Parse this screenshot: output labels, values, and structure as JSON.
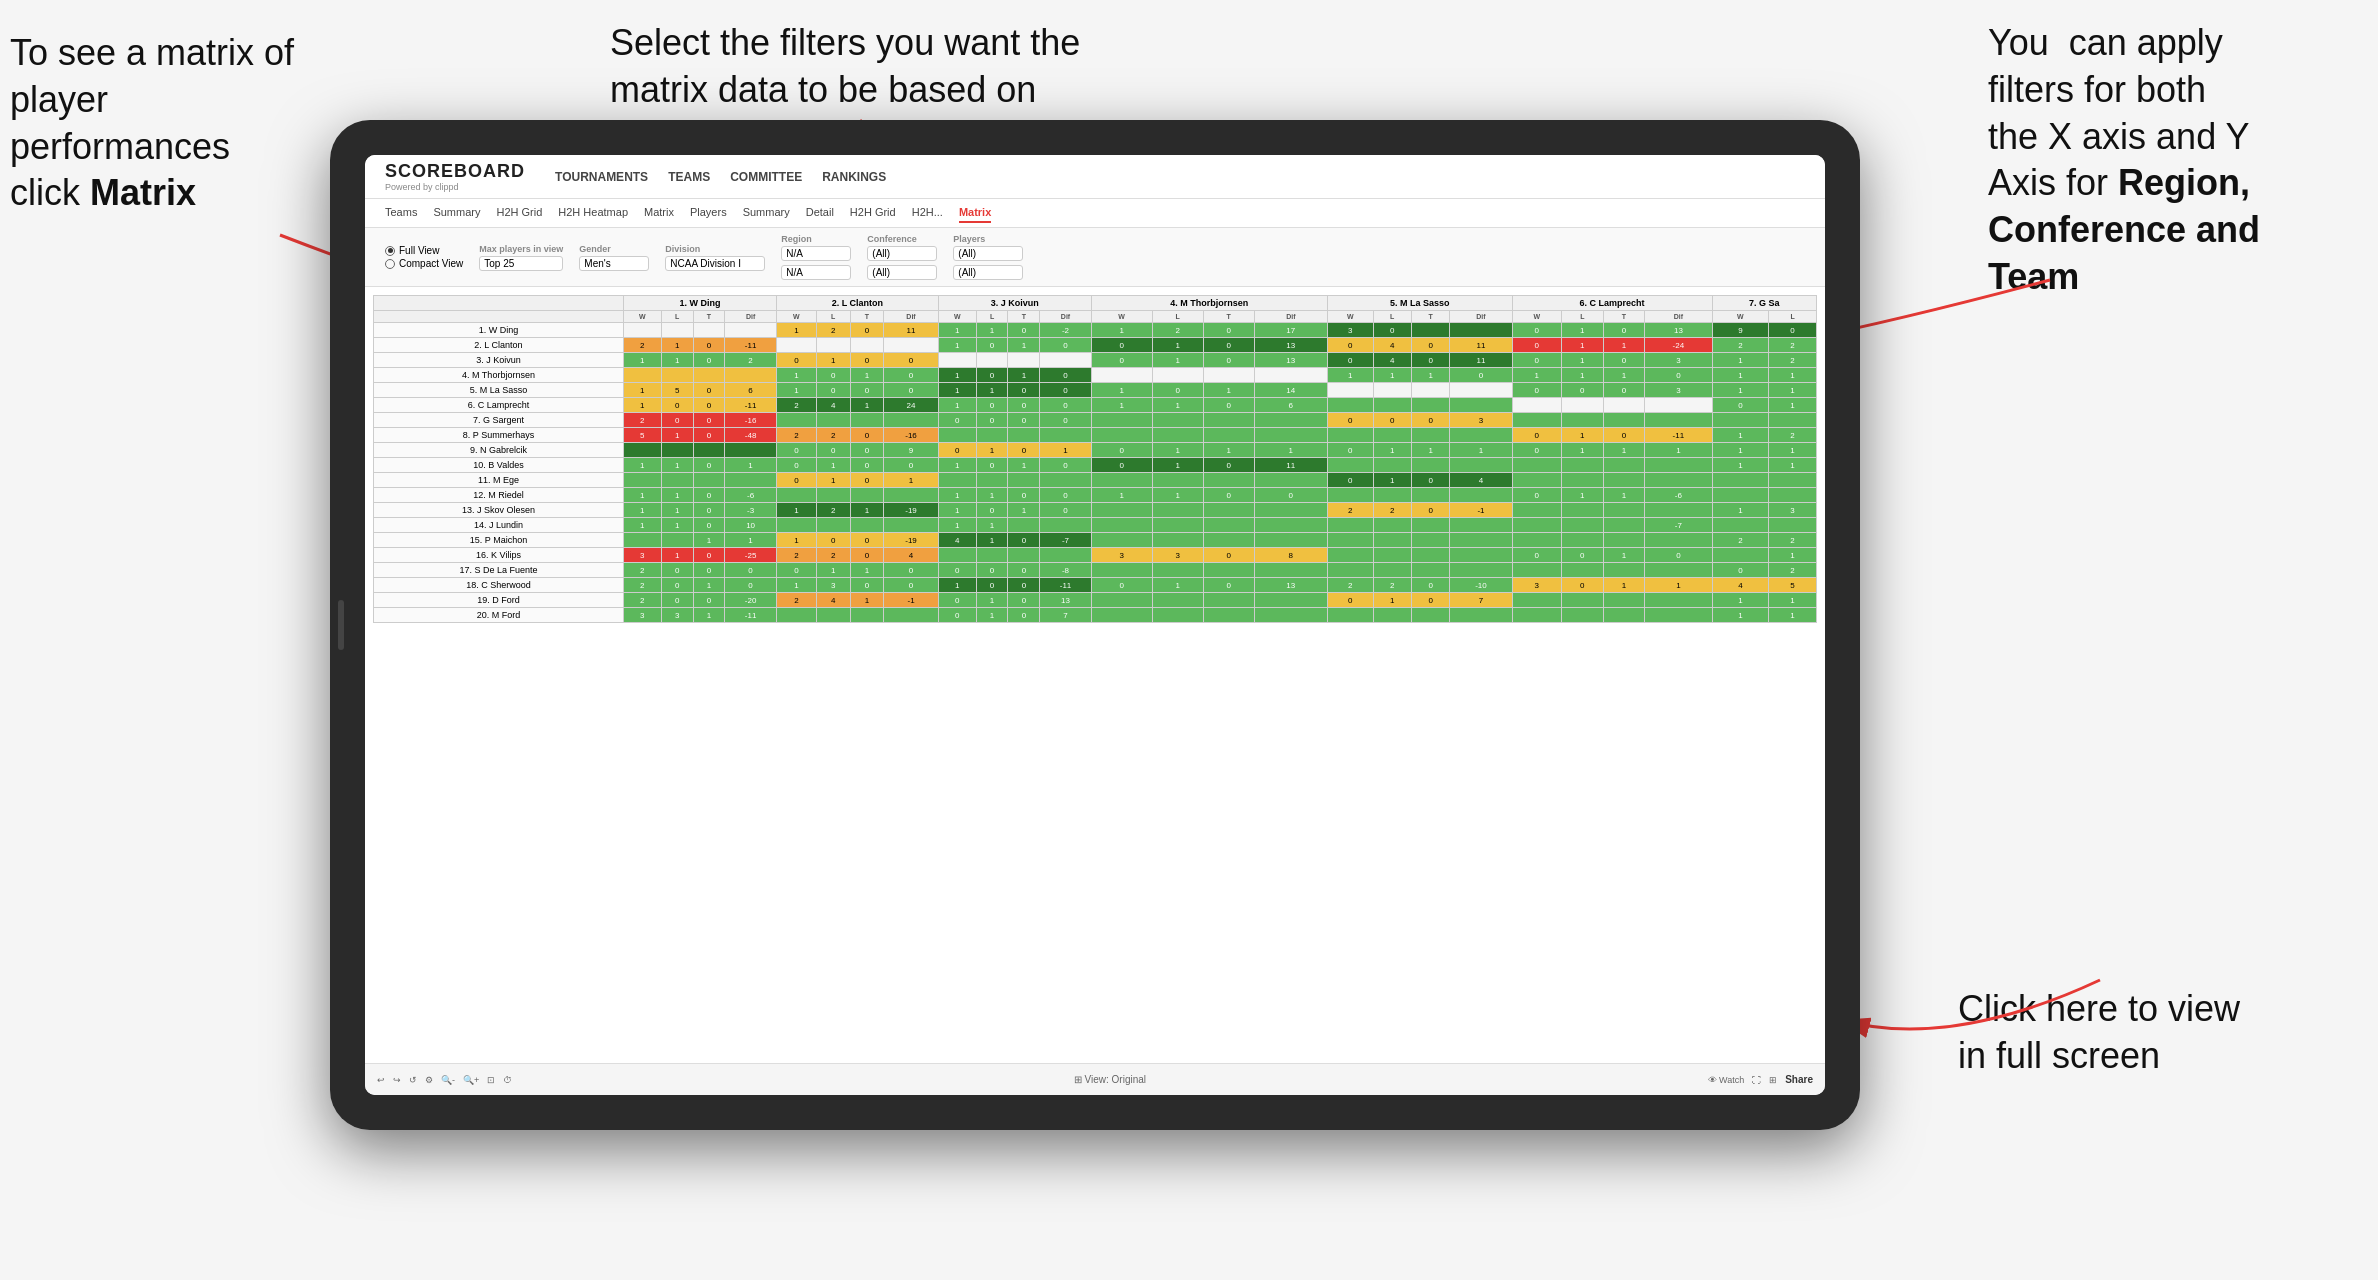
{
  "annotations": {
    "top_left": {
      "line1": "To see a matrix of",
      "line2": "player performances",
      "line3": "click ",
      "bold": "Matrix"
    },
    "top_center": "Select the filters you want the matrix data to be based on",
    "top_right": {
      "line1": "You  can apply",
      "line2": "filters for both",
      "line3": "the X axis and Y",
      "line4": "Axis for ",
      "bold1": "Region,",
      "line5": "",
      "bold2": "Conference and",
      "line6": "",
      "bold3": "Team"
    },
    "bottom_right": {
      "line1": "Click here to view",
      "line2": "in full screen"
    }
  },
  "app": {
    "logo": "SCOREBOARD",
    "logo_sub": "Powered by clippd",
    "nav": [
      "TOURNAMENTS",
      "TEAMS",
      "COMMITTEE",
      "RANKINGS"
    ],
    "sub_nav": [
      "Teams",
      "Summary",
      "H2H Grid",
      "H2H Heatmap",
      "Matrix",
      "Players",
      "Summary",
      "Detail",
      "H2H Grid",
      "H2H...",
      "Matrix"
    ],
    "active_tab": "Matrix"
  },
  "filters": {
    "view_options": [
      "Full View",
      "Compact View"
    ],
    "selected_view": "Full View",
    "max_players_label": "Max players in view",
    "max_players_value": "Top 25",
    "gender_label": "Gender",
    "gender_value": "Men's",
    "division_label": "Division",
    "division_value": "NCAA Division I",
    "region_label": "Region",
    "region_value": "N/A",
    "conference_label": "Conference",
    "conference_value1": "(All)",
    "conference_value2": "(All)",
    "players_label": "Players",
    "players_value1": "(All)",
    "players_value2": "(All)"
  },
  "matrix": {
    "col_headers": [
      "1. W Ding",
      "2. L Clanton",
      "3. J Koivun",
      "4. M Thorbjornsen",
      "5. M La Sasso",
      "6. C Lamprecht",
      "7. G Sa"
    ],
    "col_subheaders": [
      "W",
      "L",
      "T",
      "Dif"
    ],
    "rows": [
      {
        "name": "1. W Ding"
      },
      {
        "name": "2. L Clanton"
      },
      {
        "name": "3. J Koivun"
      },
      {
        "name": "4. M Thorbjornsen"
      },
      {
        "name": "5. M La Sasso"
      },
      {
        "name": "6. C Lamprecht"
      },
      {
        "name": "7. G Sargent"
      },
      {
        "name": "8. P Summerhays"
      },
      {
        "name": "9. N Gabrelcik"
      },
      {
        "name": "10. B Valdes"
      },
      {
        "name": "11. M Ege"
      },
      {
        "name": "12. M Riedel"
      },
      {
        "name": "13. J Skov Olesen"
      },
      {
        "name": "14. J Lundin"
      },
      {
        "name": "15. P Maichon"
      },
      {
        "name": "16. K Vilips"
      },
      {
        "name": "17. S De La Fuente"
      },
      {
        "name": "18. C Sherwood"
      },
      {
        "name": "19. D Ford"
      },
      {
        "name": "20. M Ford"
      }
    ]
  },
  "bottom_bar": {
    "view_original": "View: Original",
    "watch": "Watch",
    "share": "Share"
  }
}
